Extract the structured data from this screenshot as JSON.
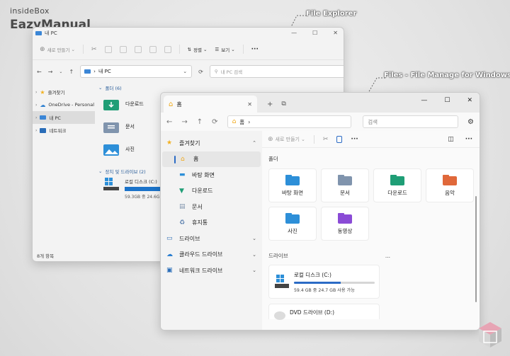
{
  "brand": {
    "line1": "insideBox",
    "line2": "EazyManual"
  },
  "callouts": {
    "explorer": "File Explorer",
    "files": "Files - File Manage for Windows"
  },
  "explorer": {
    "title": "내 PC",
    "window_controls": [
      "—",
      "☐",
      "✕"
    ],
    "toolbar": {
      "new": "새로 만들기",
      "sort": "정렬",
      "view": "보기",
      "more": "···"
    },
    "address": {
      "path": "내 PC",
      "search_placeholder": "내 PC 검색"
    },
    "nav": [
      {
        "label": "즐겨찾기",
        "icon": "star-icon"
      },
      {
        "label": "OneDrive - Personal",
        "icon": "cloud-icon"
      },
      {
        "label": "내 PC",
        "icon": "pc-icon",
        "selected": true
      },
      {
        "label": "네트워크",
        "icon": "network-icon"
      }
    ],
    "folders_header": "폴더 (6)",
    "folders": [
      "다운로드",
      "문서",
      "사진"
    ],
    "drives_header": "장치 및 드라이브 (2)",
    "drive": {
      "name": "로컬 디스크 (C:)",
      "usage": "59.3GB 중 24.6G"
    },
    "status": "8개 항목"
  },
  "files": {
    "tab": {
      "label": "홈"
    },
    "tab_tools": {
      "add": "+"
    },
    "window_controls": [
      "—",
      "☐",
      "✕"
    ],
    "address": {
      "path": "홈",
      "search_placeholder": "검색"
    },
    "sidebar": [
      {
        "label": "즐겨찾기",
        "icon": "star-icon",
        "indent": false,
        "chevron": "⌃"
      },
      {
        "label": "홈",
        "icon": "home-icon",
        "indent": true,
        "selected": true
      },
      {
        "label": "바탕 화면",
        "icon": "desktop-icon",
        "indent": true
      },
      {
        "label": "다운로드",
        "icon": "download-folder-icon",
        "indent": true
      },
      {
        "label": "문서",
        "icon": "documents-folder-icon",
        "indent": true
      },
      {
        "label": "휴지통",
        "icon": "recycle-bin-icon",
        "indent": true
      },
      {
        "label": "드라이브",
        "icon": "drive-icon",
        "indent": false,
        "chevron": "⌄"
      },
      {
        "label": "클라우드 드라이브",
        "icon": "cloud-drive-icon",
        "indent": false,
        "chevron": "⌄"
      },
      {
        "label": "네트워크 드라이브",
        "icon": "network-drive-icon",
        "indent": false,
        "chevron": "⌄"
      }
    ],
    "toolbar": {
      "new": "새로 만들기",
      "more": "···"
    },
    "folders_label": "폴더",
    "folders": [
      {
        "label": "바탕 화면",
        "color": "#2d8fd8"
      },
      {
        "label": "문서",
        "color": "#8094ad"
      },
      {
        "label": "다운로드",
        "color": "#1f9e76"
      },
      {
        "label": "음악",
        "color": "#e0683a"
      },
      {
        "label": "사진",
        "color": "#2d8fd8"
      },
      {
        "label": "동영상",
        "color": "#8a4bd6"
      }
    ],
    "drives_label": "드라이브",
    "drives_more": "...",
    "drives": [
      {
        "name": "로컬 디스크 (C:)",
        "usage": "59.4 GB 중 24.7 GB 사용 가능",
        "used_fraction": 0.58
      },
      {
        "name": "DVD 드라이브 (D:)"
      }
    ]
  }
}
